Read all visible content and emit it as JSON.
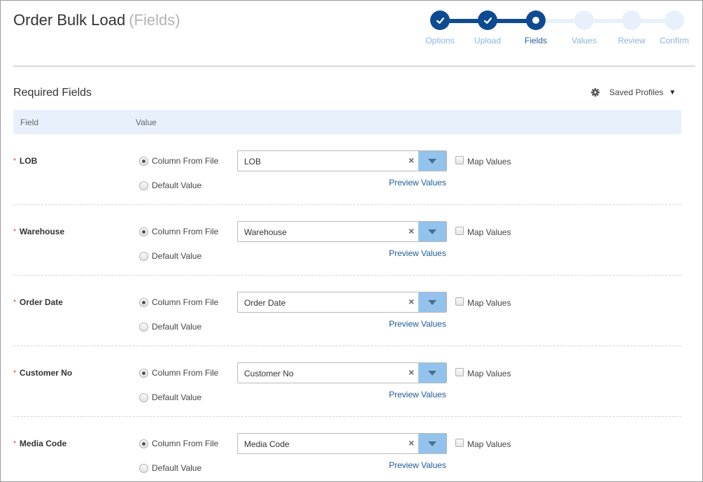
{
  "page": {
    "title": "Order Bulk Load",
    "subtitle": "(Fields)"
  },
  "colors": {
    "stepper_active": "#0d4a92",
    "stepper_inactive": "#e8f1fb",
    "header_bg": "#e8f1fb",
    "dropdown_arrow_bg": "#93c3ec",
    "link": "#1d5a96",
    "required_star": "#d9342b"
  },
  "stepper": {
    "current_step": "Fields",
    "steps": [
      {
        "label": "Options",
        "state": "done",
        "icon": "check-icon"
      },
      {
        "label": "Upload",
        "state": "done",
        "icon": "check-icon"
      },
      {
        "label": "Fields",
        "state": "current",
        "icon": "current-dot-icon"
      },
      {
        "label": "Values",
        "state": "pending",
        "icon": ""
      },
      {
        "label": "Review",
        "state": "pending",
        "icon": ""
      },
      {
        "label": "Confirm",
        "state": "pending",
        "icon": ""
      }
    ]
  },
  "section": {
    "title": "Required Fields",
    "saved_profiles": {
      "label": "Saved Profiles",
      "icon": "gear-icon",
      "caret_icon": "caret-down-icon"
    }
  },
  "table": {
    "columns": [
      "Field",
      "Value"
    ],
    "rows": [
      {
        "field": "LOB",
        "required": "*",
        "column_from_file_label": "Column From File",
        "default_value_label": "Default Value",
        "selected_source": "Column From File",
        "column": "LOB",
        "map_values_label": "Map Values",
        "map_values_checked": false,
        "preview_label": "Preview Values"
      },
      {
        "field": "Warehouse",
        "required": "*",
        "column_from_file_label": "Column From File",
        "default_value_label": "Default Value",
        "selected_source": "Column From File",
        "column": "Warehouse",
        "map_values_label": "Map Values",
        "map_values_checked": false,
        "preview_label": "Preview Values"
      },
      {
        "field": "Order Date",
        "required": "*",
        "column_from_file_label": "Column From File",
        "default_value_label": "Default Value",
        "selected_source": "Column From File",
        "column": "Order Date",
        "map_values_label": "Map Values",
        "map_values_checked": false,
        "preview_label": "Preview Values"
      },
      {
        "field": "Customer No",
        "required": "*",
        "column_from_file_label": "Column From File",
        "default_value_label": "Default Value",
        "selected_source": "Column From File",
        "column": "Customer No",
        "map_values_label": "Map Values",
        "map_values_checked": false,
        "preview_label": "Preview Values"
      },
      {
        "field": "Media Code",
        "required": "*",
        "column_from_file_label": "Column From File",
        "default_value_label": "Default Value",
        "selected_source": "Column From File",
        "column": "Media Code",
        "map_values_label": "Map Values",
        "map_values_checked": false,
        "preview_label": "Preview Values"
      }
    ]
  }
}
